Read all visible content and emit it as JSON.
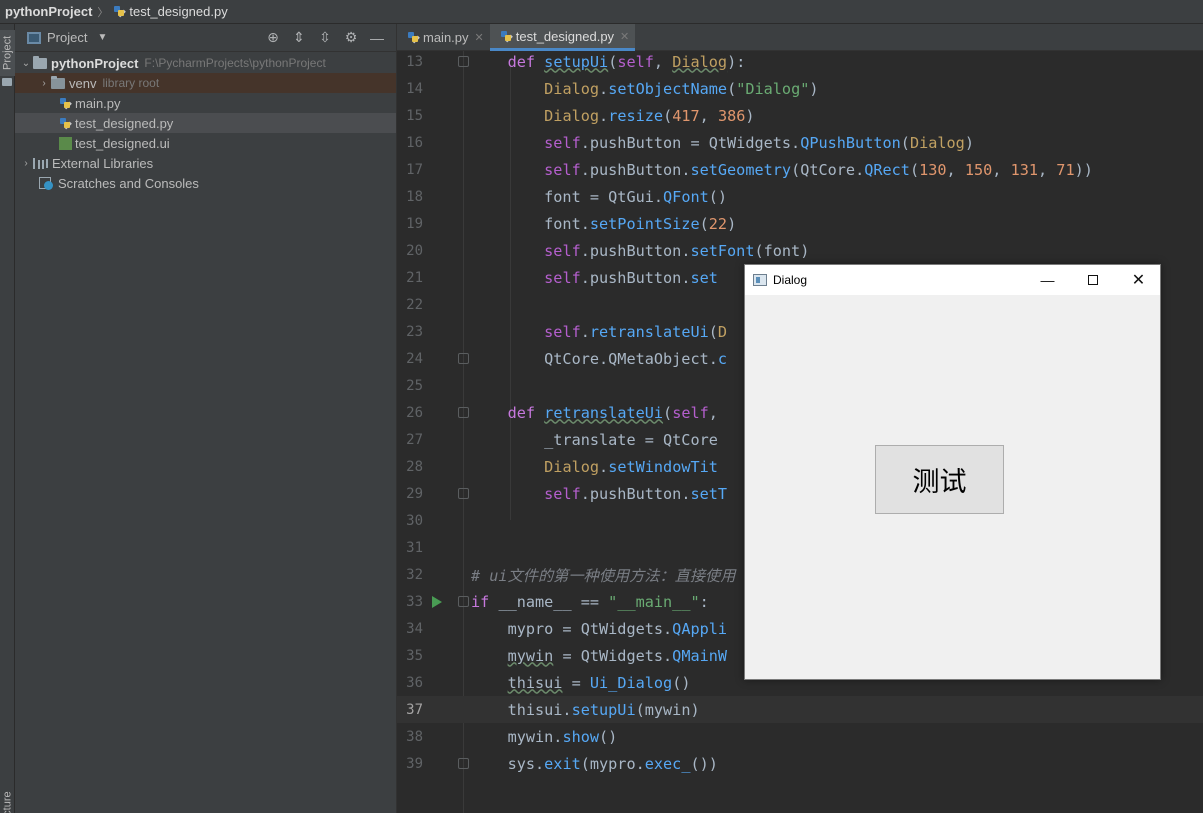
{
  "breadcrumb": {
    "project": "pythonProject",
    "file": "test_designed.py"
  },
  "sidebar_tabs": {
    "project": "Project",
    "structure": "Structure"
  },
  "project_panel": {
    "title": "Project",
    "tree": [
      {
        "label": "pythonProject",
        "hint": "F:\\PycharmProjects\\pythonProject"
      },
      {
        "label": "venv",
        "hint": "library root"
      },
      {
        "label": "main.py"
      },
      {
        "label": "test_designed.py"
      },
      {
        "label": "test_designed.ui"
      },
      {
        "label": "External Libraries"
      },
      {
        "label": "Scratches and Consoles"
      }
    ]
  },
  "editor": {
    "tabs": [
      {
        "label": "main.py"
      },
      {
        "label": "test_designed.py"
      }
    ],
    "line_numbers": [
      "13",
      "14",
      "15",
      "16",
      "17",
      "18",
      "19",
      "20",
      "21",
      "22",
      "23",
      "24",
      "25",
      "26",
      "27",
      "28",
      "29",
      "30",
      "31",
      "32",
      "33",
      "34",
      "35",
      "36",
      "37",
      "38",
      "39"
    ],
    "current_line": "37"
  },
  "dialog": {
    "title": "Dialog",
    "button_label": "测试"
  },
  "colors": {
    "editor_bg": "#2b2b2b",
    "panel_bg": "#3c3f41",
    "accent": "#4a88c7"
  }
}
